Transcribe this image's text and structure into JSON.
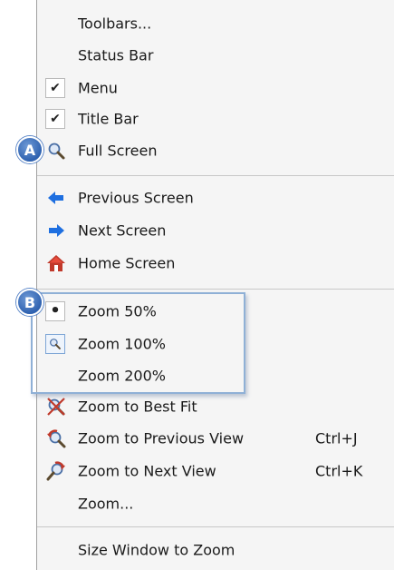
{
  "menu": {
    "items": [
      {
        "label": "Toolbars...",
        "check": "none",
        "icon": null
      },
      {
        "label": "Status Bar",
        "check": "none",
        "icon": null
      },
      {
        "label": "Menu",
        "check": "check",
        "icon": null
      },
      {
        "label": "Title Bar",
        "check": "check",
        "icon": null
      },
      {
        "label": "Full Screen",
        "check": "none",
        "icon": "magnifier-icon"
      },
      {
        "label": "Previous Screen",
        "check": "none",
        "icon": "arrow-left-icon"
      },
      {
        "label": "Next Screen",
        "check": "none",
        "icon": "arrow-right-icon"
      },
      {
        "label": "Home Screen",
        "check": "none",
        "icon": "home-icon"
      },
      {
        "label": "Zoom 50%",
        "check": "dot",
        "icon": null
      },
      {
        "label": "Zoom 100%",
        "check": "box-icon",
        "icon": "zoom-box-icon"
      },
      {
        "label": "Zoom 200%",
        "check": "none",
        "icon": null
      },
      {
        "label": "Zoom to Best Fit",
        "check": "none",
        "icon": "zoom-best-fit-icon"
      },
      {
        "label": "Zoom to Previous View",
        "shortcut": "Ctrl+J",
        "check": "none",
        "icon": "zoom-previous-icon"
      },
      {
        "label": "Zoom to Next View",
        "shortcut": "Ctrl+K",
        "check": "none",
        "icon": "zoom-next-icon"
      },
      {
        "label": "Zoom...",
        "check": "none",
        "icon": null
      },
      {
        "label": "Size Window to Zoom",
        "check": "none",
        "icon": null
      }
    ]
  },
  "callouts": {
    "a": "A",
    "b": "B"
  },
  "colors": {
    "menu_bg": "#f5f5f5",
    "arrow_blue": "#1e6fe0",
    "callout_blue": "#2f62b0",
    "highlight_border": "#8fb0d6"
  }
}
